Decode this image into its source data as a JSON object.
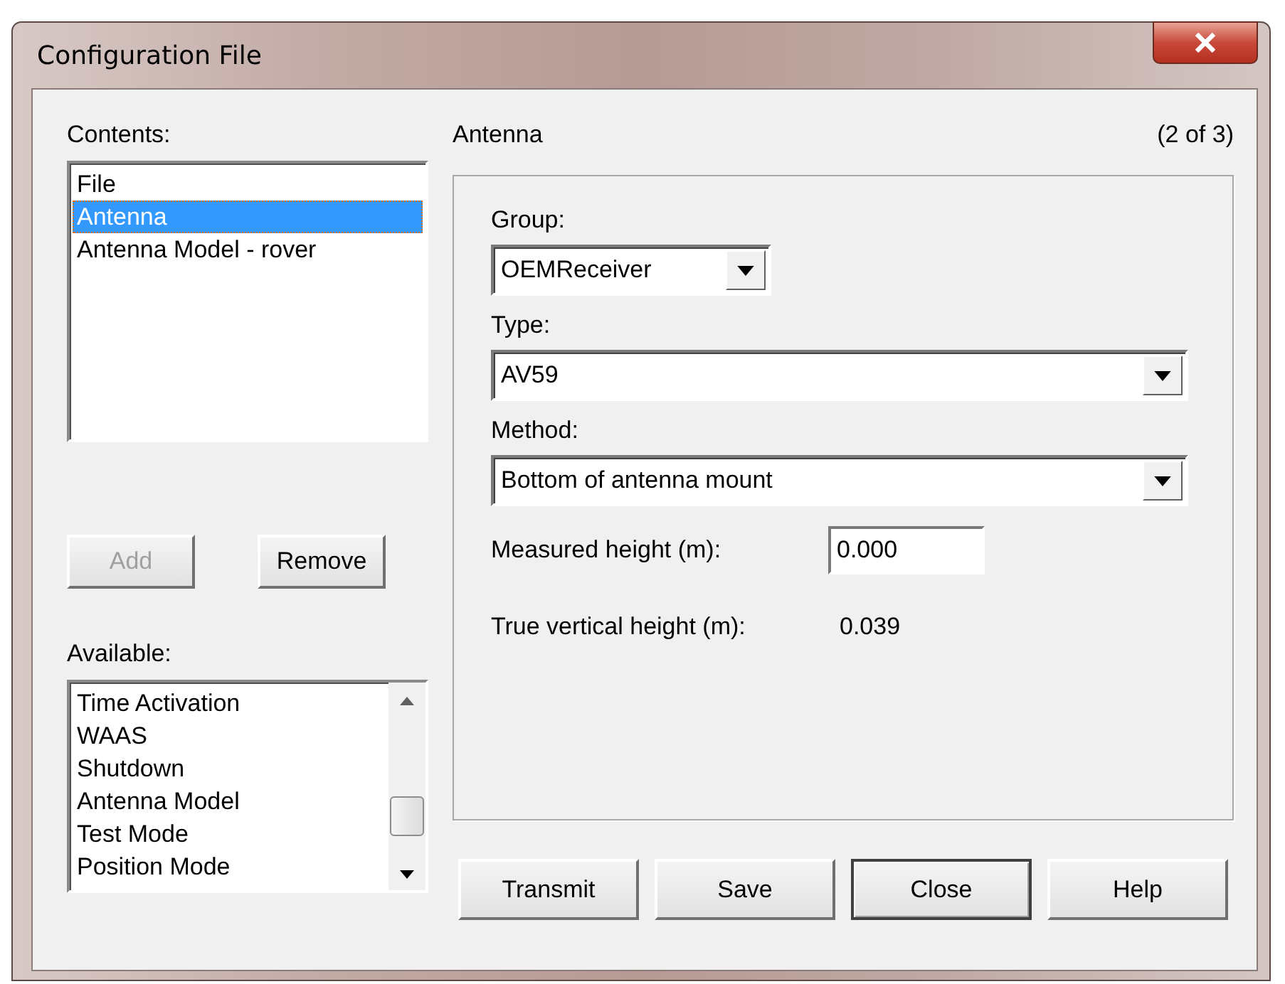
{
  "window": {
    "title": "Configuration File"
  },
  "contents": {
    "label": "Contents:",
    "items": [
      {
        "label": "File",
        "selected": false
      },
      {
        "label": "Antenna",
        "selected": true
      },
      {
        "label": "Antenna Model - rover",
        "selected": false
      }
    ]
  },
  "list_buttons": [
    {
      "label": "Add",
      "disabled": true
    },
    {
      "label": "Remove",
      "disabled": false
    }
  ],
  "available": {
    "label": "Available:",
    "items": [
      {
        "label": "Time Activation",
        "selected": false
      },
      {
        "label": "WAAS",
        "selected": false
      },
      {
        "label": "Shutdown",
        "selected": false
      },
      {
        "label": "Antenna Model",
        "selected": false
      },
      {
        "label": "Test Mode",
        "selected": false
      },
      {
        "label": "Position Mode",
        "selected": false
      }
    ]
  },
  "section": {
    "title": "Antenna",
    "counter": "(2 of 3)"
  },
  "fields": [
    {
      "kind": "dropdown",
      "label": "Group:",
      "value": "OEMReceiver"
    },
    {
      "kind": "dropdown",
      "label": "Type:",
      "value": "AV59"
    },
    {
      "kind": "dropdown",
      "label": "Method:",
      "value": "Bottom of antenna mount"
    },
    {
      "kind": "input",
      "label": "Measured height (m):",
      "value": "0.000"
    },
    {
      "kind": "readout",
      "label": "True vertical height (m):",
      "value": "0.039"
    }
  ],
  "buttons": [
    {
      "label": "Transmit",
      "default": false
    },
    {
      "label": "Save",
      "default": false
    },
    {
      "label": "Close",
      "default": true
    },
    {
      "label": "Help",
      "default": false
    }
  ]
}
